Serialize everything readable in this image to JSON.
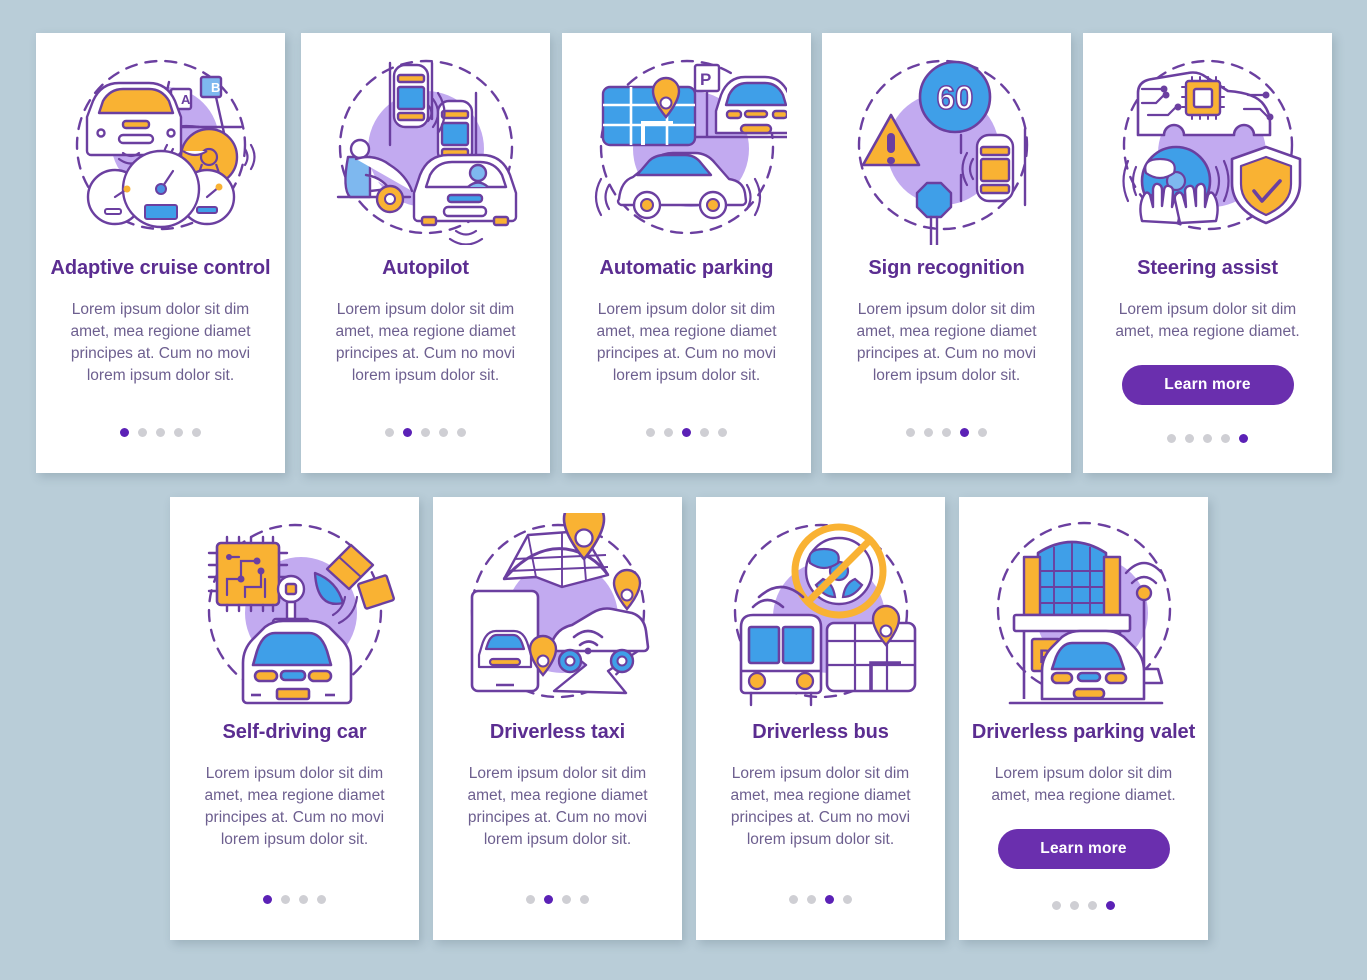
{
  "page": {
    "background_color": "#b9cdd8",
    "card_background": "#ffffff",
    "title_color": "#5b2d91",
    "body_color": "#6d5f8f",
    "accent_color": "#6a2fae",
    "dot_active_color": "#5b21b6",
    "dot_inactive_color": "#cfcfd4"
  },
  "body_text_long": "Lorem ipsum dolor sit dim amet, mea regione diamet principes at. Cum no movi lorem ipsum dolor sit.",
  "body_text_short": "Lorem ipsum dolor sit dim amet, mea regione diamet.",
  "learn_more_label": "Learn more",
  "rows": [
    {
      "name": "top-row",
      "cards": [
        {
          "id": "adaptive-cruise-control",
          "title": "Adaptive cruise control",
          "description": "Lorem ipsum dolor sit dim amet, mea regione diamet principes at. Cum no movi lorem ipsum dolor sit.",
          "illustration": "adaptive-cruise-control-illustration",
          "button": null,
          "dots": {
            "count": 5,
            "active_index": 0
          }
        },
        {
          "id": "autopilot",
          "title": "Autopilot",
          "description": "Lorem ipsum dolor sit dim amet, mea regione diamet principes at. Cum no movi lorem ipsum dolor sit.",
          "illustration": "autopilot-illustration",
          "button": null,
          "dots": {
            "count": 5,
            "active_index": 1
          }
        },
        {
          "id": "automatic-parking",
          "title": "Automatic parking",
          "description": "Lorem ipsum dolor sit dim amet, mea regione diamet principes at. Cum no movi lorem ipsum dolor sit.",
          "illustration": "automatic-parking-illustration",
          "button": null,
          "dots": {
            "count": 5,
            "active_index": 2
          }
        },
        {
          "id": "sign-recognition",
          "title": "Sign recognition",
          "description": "Lorem ipsum dolor sit dim amet, mea regione diamet principes at. Cum no movi lorem ipsum dolor sit.",
          "illustration": "sign-recognition-illustration",
          "illustration_label": "60",
          "button": null,
          "dots": {
            "count": 5,
            "active_index": 3
          }
        },
        {
          "id": "steering-assist",
          "title": "Steering assist",
          "description": "Lorem ipsum dolor sit dim amet, mea regione diamet.",
          "illustration": "steering-assist-illustration",
          "button": "Learn more",
          "dots": {
            "count": 5,
            "active_index": 4
          }
        }
      ]
    },
    {
      "name": "bottom-row",
      "cards": [
        {
          "id": "self-driving-car",
          "title": "Self-driving car",
          "description": "Lorem ipsum dolor sit dim amet, mea regione diamet principes at. Cum no movi lorem ipsum dolor sit.",
          "illustration": "self-driving-car-illustration",
          "button": null,
          "dots": {
            "count": 4,
            "active_index": 0
          }
        },
        {
          "id": "driverless-taxi",
          "title": "Driverless taxi",
          "description": "Lorem ipsum dolor sit dim amet, mea regione diamet principes at. Cum no movi lorem ipsum dolor sit.",
          "illustration": "driverless-taxi-illustration",
          "button": null,
          "dots": {
            "count": 4,
            "active_index": 1
          }
        },
        {
          "id": "driverless-bus",
          "title": "Driverless bus",
          "description": "Lorem ipsum dolor sit dim amet, mea regione diamet principes at. Cum no movi lorem ipsum dolor sit.",
          "illustration": "driverless-bus-illustration",
          "button": null,
          "dots": {
            "count": 4,
            "active_index": 2
          }
        },
        {
          "id": "driverless-parking-valet",
          "title": "Driverless parking valet",
          "description": "Lorem ipsum dolor sit dim amet, mea regione diamet.",
          "illustration": "driverless-parking-valet-illustration",
          "illustration_label": "P",
          "button": "Learn more",
          "dots": {
            "count": 4,
            "active_index": 3
          }
        }
      ]
    }
  ]
}
